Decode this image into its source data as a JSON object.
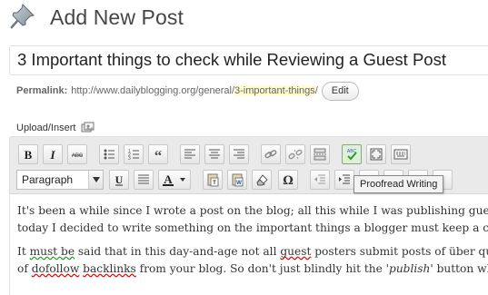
{
  "header": {
    "title": "Add New Post",
    "icon": "pushpin-icon"
  },
  "post": {
    "title": "3 Important things to check while Reviewing a Guest Post"
  },
  "permalink": {
    "label": "Permalink:",
    "base": "http://www.dailyblogging.org/general/",
    "slug": "3-important-things",
    "suffix": "/",
    "edit_label": "Edit"
  },
  "upload": {
    "label": "Upload/Insert",
    "icon": "media-insert-icon"
  },
  "toolbar": {
    "row1": [
      "bold",
      "italic",
      "strikethrough",
      "unordered-list",
      "ordered-list",
      "blockquote",
      "align-left",
      "align-center",
      "align-right",
      "link",
      "unlink",
      "more-tag",
      "spellcheck",
      "fullscreen",
      "kitchen-sink"
    ],
    "row2": [
      "underline",
      "justify",
      "text-color",
      "paste-text",
      "paste-word",
      "remove-format",
      "special-character",
      "outdent",
      "indent"
    ],
    "format": "Paragraph"
  },
  "tooltip": {
    "text": "Proofread Writing"
  },
  "content": {
    "p1_line1": "It's been a while since I wrote a post on the blog; all this while I was publishing guest",
    "p1_line2": "today I decided to write something on the important things a blogger must keep a ch",
    "p2_line1_a": "It ",
    "p2_line1_must": "must be",
    "p2_line1_b": " said that in this day-and-age not all ",
    "p2_line1_guest": "guest",
    "p2_line1_c": " posters submit posts of über qua",
    "p2_line2_a": "of ",
    "p2_line2_dofollow": "dofollow",
    "p2_line2_sp": " ",
    "p2_line2_backlinks": "backlinks",
    "p2_line2_b": " from your blog. So don't just blindly hit the '",
    "p2_line2_publish": "publish",
    "p2_line2_c": "' button whe"
  },
  "colors": {
    "spell_error": "#e00000",
    "grammar_hint": "#2a9d2a",
    "slug_highlight": "#fffbcc",
    "title_text": "#464646"
  }
}
